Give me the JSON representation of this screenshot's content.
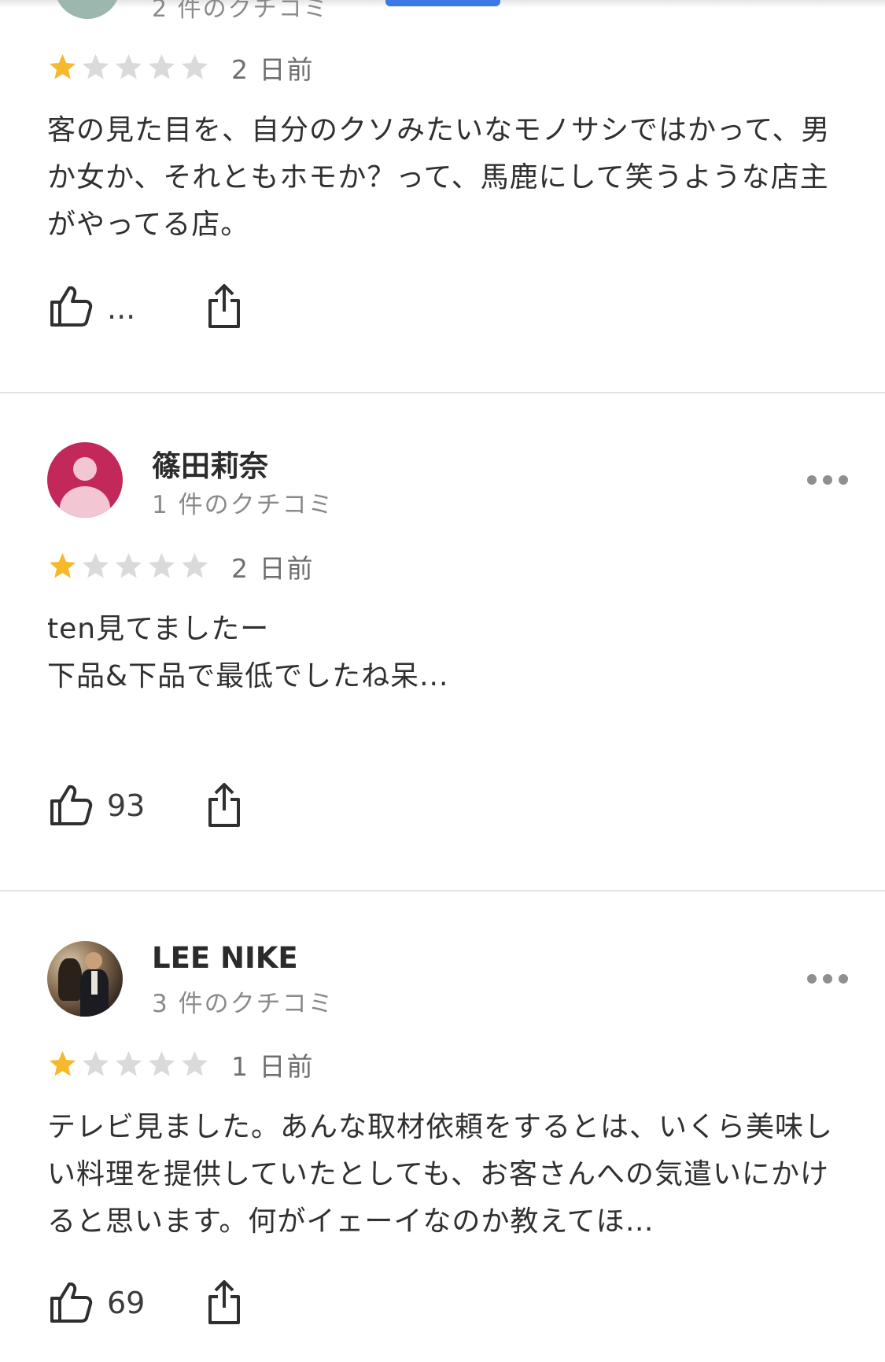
{
  "top_partial": {
    "review_count": "2 件のクチコミ"
  },
  "reviews": [
    {
      "reviewer_name": "",
      "review_count": "2 件のクチコミ",
      "rating": 1,
      "max_rating": 5,
      "date": "2 日前",
      "text": "客の見た目を、自分のクソみたいなモノサシではかって、男か女か、それともホモか？って、馬鹿にして笑うような店主がやってる店。",
      "likes": "..."
    },
    {
      "reviewer_name": "篠田莉奈",
      "review_count": "1 件のクチコミ",
      "avatar": "default-person-avatar",
      "rating": 1,
      "max_rating": 5,
      "date": "2 日前",
      "text": "ten見てましたー\n下品&下品で最低でしたね呆...",
      "likes": "93"
    },
    {
      "reviewer_name": "LEE NIKE",
      "review_count": "3 件のクチコミ",
      "avatar": "photo-avatar",
      "rating": 1,
      "max_rating": 5,
      "date": "1 日前",
      "text": "テレビ見ました。あんな取材依頼をするとは、いくら美味しい料理を提供していたとしても、お客さんへの気遣いにかけると思います。何がイェーイなのか教えてほ…",
      "likes": "69"
    }
  ],
  "icons": {
    "like": "thumbs-up-icon",
    "share": "share-icon",
    "more": "more-horizontal-icon",
    "star": "star-icon"
  },
  "colors": {
    "star_filled": "#f6b92b",
    "star_empty": "#dadada",
    "accent_blue": "#3c78e6",
    "avatar_default": "#c2295a"
  }
}
